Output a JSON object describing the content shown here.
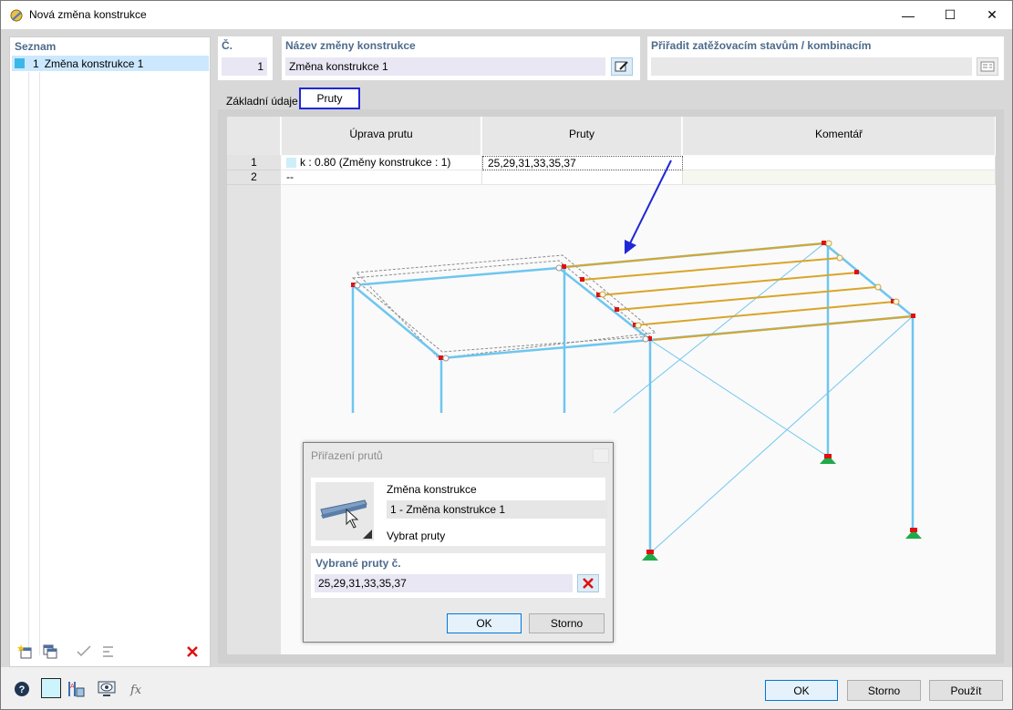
{
  "window": {
    "title": "Nová změna konstrukce",
    "min": "—",
    "max": "☐",
    "close": "✕"
  },
  "list": {
    "header": "Seznam",
    "items": [
      {
        "number": "1",
        "label": "Změna konstrukce 1"
      }
    ]
  },
  "header": {
    "no_label": "Č.",
    "no_value": "1",
    "name_label": "Název změny konstrukce",
    "name_value": "Změna konstrukce 1",
    "assign_label": "Přiřadit zatěžovacím stavům / kombinacím",
    "assign_value": ""
  },
  "tabs": [
    {
      "label": "Základní údaje"
    },
    {
      "label": "Pruty"
    }
  ],
  "table": {
    "columns": [
      "Úprava prutu",
      "Pruty",
      "Komentář"
    ],
    "rows": [
      {
        "num": "1",
        "modification": "k : 0.80 (Změny konstrukce : 1)",
        "members": "25,29,31,33,35,37",
        "comment": ""
      },
      {
        "num": "2",
        "modification": "--",
        "members": "",
        "comment": ""
      }
    ]
  },
  "dialog": {
    "title": "Přiřazení prutů",
    "group_label": "Změna konstrukce",
    "selected_change": "1 - Změna konstrukce 1",
    "select_members": "Vybrat pruty",
    "selected_label": "Vybrané pruty č.",
    "selected_value": "25,29,31,33,35,37",
    "ok": "OK",
    "cancel": "Storno"
  },
  "footer": {
    "ok": "OK",
    "cancel": "Storno",
    "apply": "Použít"
  },
  "colors": {
    "accent_header": "#4d6b8c",
    "selection": "#cce8ff",
    "member_blue": "#6ec6ef",
    "member_modified": "#d9a528",
    "arrow": "#1f28d6",
    "support": "#1faa4a",
    "delete": "#e01010"
  }
}
